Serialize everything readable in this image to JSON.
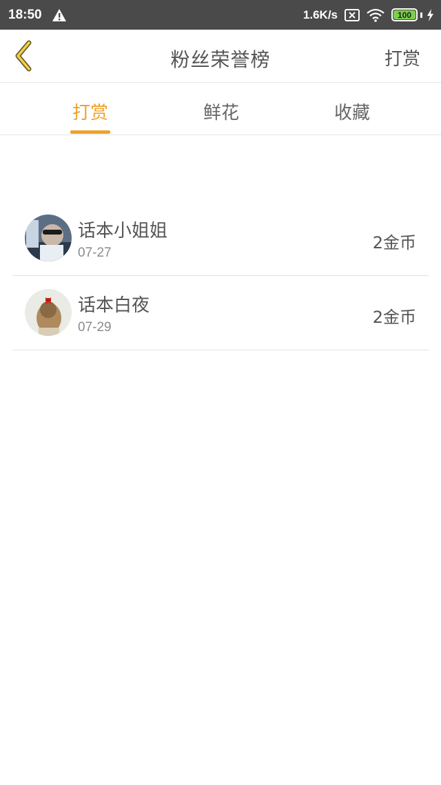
{
  "status_bar": {
    "time": "18:50",
    "net_speed": "1.6K/s",
    "battery": "100",
    "icons": [
      "warning-icon",
      "sim-x-icon",
      "wifi-icon",
      "battery-icon",
      "charging-bolt-icon"
    ]
  },
  "header": {
    "title": "粉丝荣誉榜",
    "action": "打赏",
    "back_icon": "chevron-left-icon"
  },
  "tabs": [
    {
      "label": "打赏",
      "active": true
    },
    {
      "label": "鲜花",
      "active": false
    },
    {
      "label": "收藏",
      "active": false
    }
  ],
  "list": [
    {
      "name": "话本小姐姐",
      "date": "07-27",
      "amount": "2金币"
    },
    {
      "name": "话本白夜",
      "date": "07-29",
      "amount": "2金币"
    }
  ],
  "colors": {
    "accent": "#f0a12a",
    "status_bar": "#4a4a4a",
    "battery": "#7ccf4a",
    "text": "#555555",
    "muted": "#8a8a8a"
  }
}
